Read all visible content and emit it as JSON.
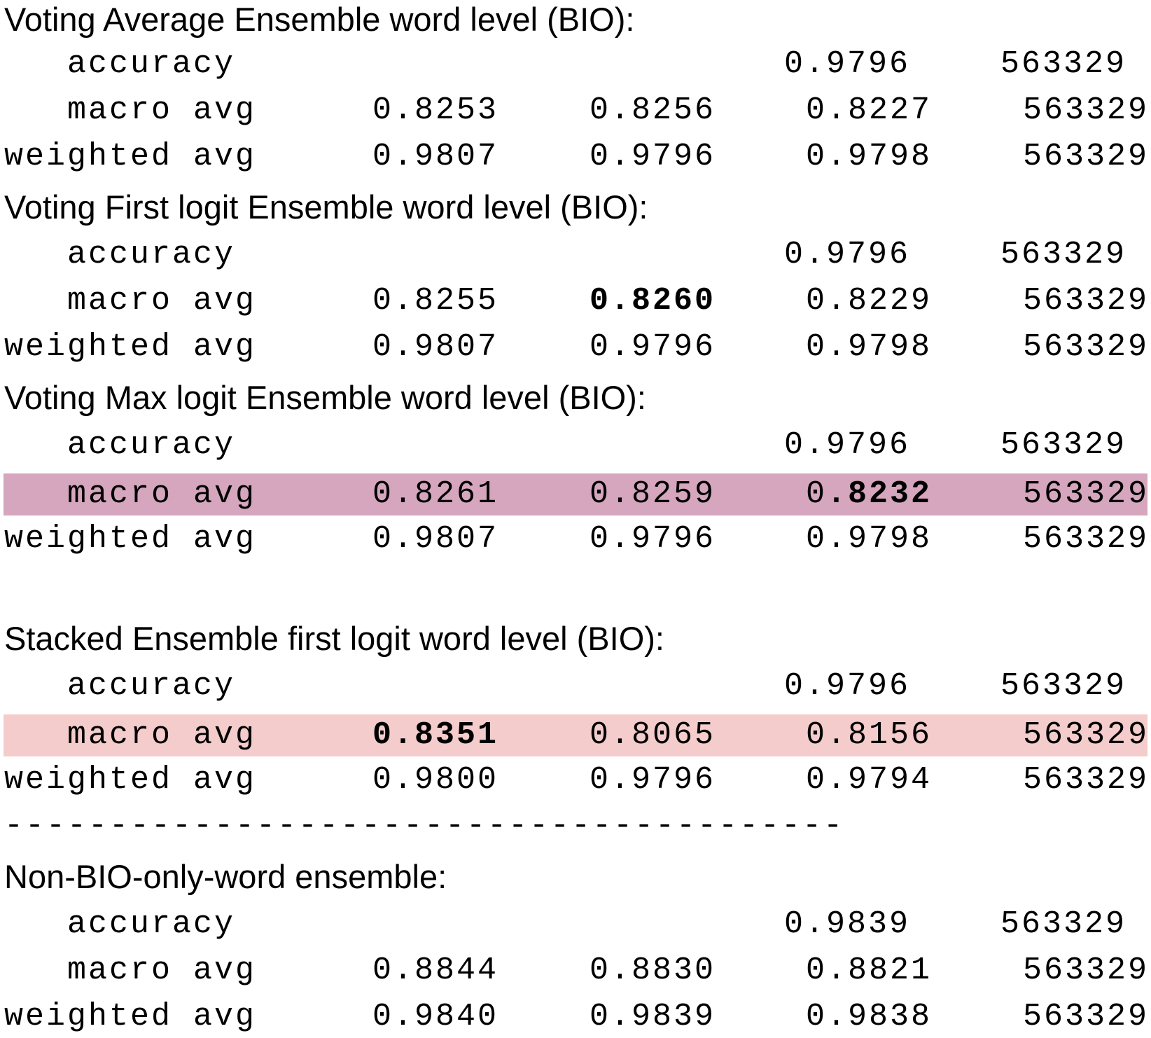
{
  "sections": [
    {
      "title": "Voting Average Ensemble word level (BIO):",
      "accuracy": {
        "label": "accuracy",
        "value": "0.9796",
        "support": "563329"
      },
      "macro": {
        "label": "macro avg",
        "v1": "0.8253",
        "v2": "0.8256",
        "v3": "0.8227",
        "support": "563329"
      },
      "weighted": {
        "label": "weighted avg",
        "v1": "0.9807",
        "v2": "0.9796",
        "v3": "0.9798",
        "support": "563329"
      }
    },
    {
      "title": "Voting First logit Ensemble word level (BIO):",
      "accuracy": {
        "label": "accuracy",
        "value": "0.9796",
        "support": "563329"
      },
      "macro": {
        "label": "macro avg",
        "v1": "0.8255",
        "v2": "0.8260",
        "v3": "0.8229",
        "support": "563329"
      },
      "weighted": {
        "label": "weighted avg",
        "v1": "0.9807",
        "v2": "0.9796",
        "v3": "0.9798",
        "support": "563329"
      }
    },
    {
      "title": "Voting Max logit Ensemble word level (BIO):",
      "accuracy": {
        "label": "accuracy",
        "value": "0.9796",
        "support": "563329"
      },
      "macro": {
        "label": "macro avg",
        "v1": "0.8261",
        "v2": "0.8259",
        "v3_prefix": "0",
        "v3_bold": ".8232",
        "support": "563329"
      },
      "weighted": {
        "label": "weighted avg",
        "v1": "0.9807",
        "v2": "0.9796",
        "v3": "0.9798",
        "support": "563329"
      }
    },
    {
      "title": "Stacked Ensemble first logit word level (BIO):",
      "accuracy": {
        "label": "accuracy",
        "value": "0.9796",
        "support": "563329"
      },
      "macro": {
        "label": "macro avg",
        "v1": "0.8351",
        "v2": "0.8065",
        "v3": "0.8156",
        "support": "563329"
      },
      "weighted": {
        "label": "weighted avg",
        "v1": "0.9800",
        "v2": "0.9796",
        "v3": "0.9794",
        "support": "563329"
      }
    },
    {
      "title": "Non-BIO-only-word ensemble:",
      "accuracy": {
        "label": "accuracy",
        "value": "0.9839",
        "support": "563329"
      },
      "macro": {
        "label": "macro avg",
        "v1": "0.8844",
        "v2": "0.8830",
        "v3": "0.8821",
        "support": "563329"
      },
      "weighted": {
        "label": "weighted avg",
        "v1": "0.9840",
        "v2": "0.9839",
        "v3": "0.9838",
        "support": "563329"
      }
    }
  ],
  "divider": "----------------------------------------",
  "highlight_colors": {
    "purple": "#d5a6bd",
    "pink": "#f4cccc"
  }
}
